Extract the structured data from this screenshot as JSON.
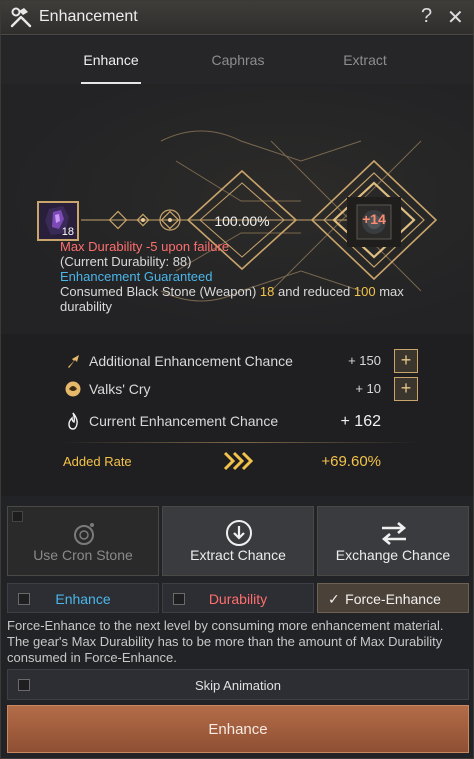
{
  "window": {
    "title": "Enhancement",
    "help_label": "?",
    "close_label": "✕"
  },
  "tabs": [
    {
      "label": "Enhance",
      "active": true
    },
    {
      "label": "Caphras",
      "active": false
    },
    {
      "label": "Extract",
      "active": false
    }
  ],
  "enhancement": {
    "stone_count": "18",
    "success_rate": "100.00%",
    "target_level": "+14",
    "messages": {
      "max_durability_warning": "Max Durability -5 upon failure",
      "current_durability": "(Current Durability: 88)",
      "guaranteed": "Enhancement Guaranteed",
      "consumed_prefix": "Consumed Black Stone (Weapon) ",
      "consumed_stones": "18",
      "consumed_middle": " and reduced ",
      "consumed_durability": "100",
      "consumed_suffix": " max durability"
    }
  },
  "chance": {
    "additional": {
      "label": "Additional Enhancement Chance",
      "value": "+ 150",
      "icon": "arrow-up-icon"
    },
    "valks": {
      "label": "Valks' Cry",
      "value": "+ 10",
      "icon": "valks-icon"
    },
    "current": {
      "label": "Current Enhancement Chance",
      "value": "+ 162",
      "icon": "flame-icon"
    },
    "plus_label": "+",
    "added_rate_label": "Added Rate",
    "added_rate_value": "+69.60%"
  },
  "actions": [
    {
      "label": "Use Cron Stone",
      "icon": "cron-stone-icon",
      "enabled": false
    },
    {
      "label": "Extract Chance",
      "icon": "extract-arrow-icon",
      "enabled": true
    },
    {
      "label": "Exchange Chance",
      "icon": "exchange-arrows-icon",
      "enabled": true
    }
  ],
  "options": [
    {
      "label": "Enhance",
      "checked": false,
      "color": "#4ab6ea"
    },
    {
      "label": "Durability",
      "checked": false,
      "color": "#ff6e6e"
    },
    {
      "label": "Force-Enhance",
      "checked": true,
      "color": "#f0f0f0"
    }
  ],
  "check_mark": "✓",
  "description": "Force-Enhance to the next level by consuming more enhancement material. The gear's Max Durability has to be more than the amount of Max Durability consumed in Force-Enhance.",
  "skip_animation_label": "Skip Animation",
  "enhance_button_label": "Enhance",
  "colors": {
    "accent_gold": "#c9a46b",
    "highlight_yellow": "#f3c24a",
    "warning_red": "#ff6e6e",
    "info_blue": "#4ab6ea",
    "enhance_button": "#a55f3f"
  }
}
